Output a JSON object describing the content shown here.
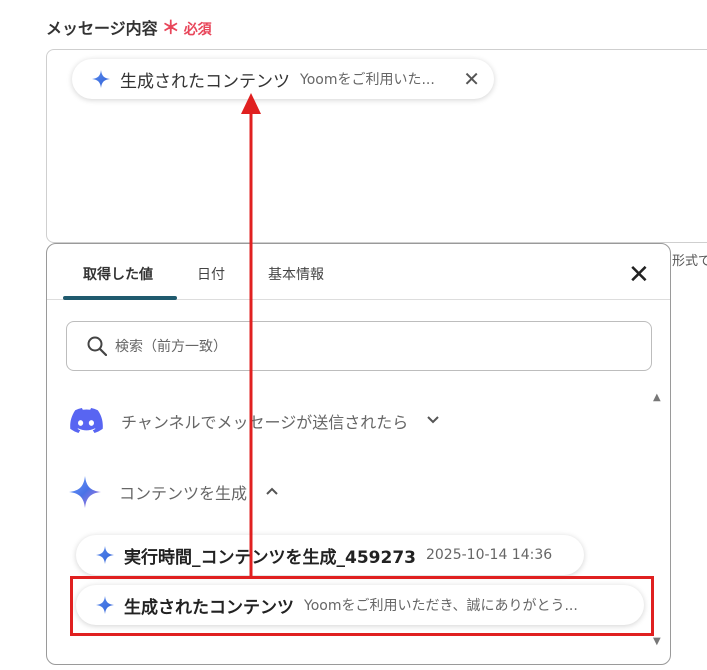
{
  "field": {
    "label": "メッセージ内容",
    "required_mark": "＊",
    "required": "必須"
  },
  "chip": {
    "title": "生成されたコンテンツ",
    "preview": "Yoomをご利用いた...",
    "close": "✕"
  },
  "side_text": "形式で",
  "panel": {
    "tabs": [
      {
        "label": "取得した値"
      },
      {
        "label": "日付"
      },
      {
        "label": "基本情報"
      }
    ],
    "close": "✕",
    "search": {
      "placeholder": "検索（前方一致）"
    },
    "groups": [
      {
        "label": "チャンネルでメッセージが送信されたら",
        "icon": "discord-icon",
        "expanded": false
      },
      {
        "label": "コンテンツを生成",
        "icon": "sparkle-icon",
        "expanded": true
      }
    ],
    "items": [
      {
        "title": "実行時間_コンテンツを生成_459273",
        "sub": "2025-10-14 14:36"
      },
      {
        "title": "生成されたコンテンツ",
        "sub": "Yoomをご利用いただき、誠にありがとう..."
      }
    ]
  },
  "colors": {
    "accent": "#1f5a6e",
    "highlight": "#e02020",
    "required": "#e8465a",
    "discord": "#5865f2"
  }
}
